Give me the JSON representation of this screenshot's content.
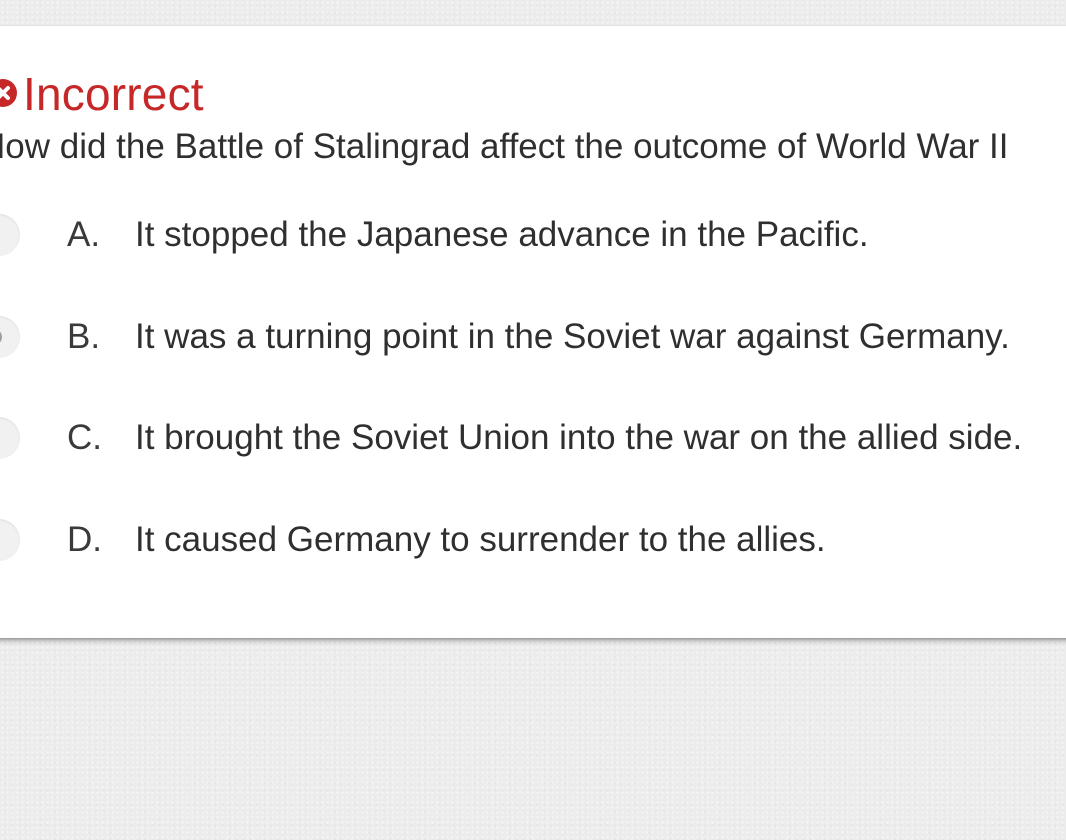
{
  "result": {
    "status_label": "Incorrect",
    "status_icon": "close-circle-icon",
    "status_color": "#c62828"
  },
  "question": {
    "text": "How did the Battle of Stalingrad affect the outcome of World War II"
  },
  "options": [
    {
      "letter": "A.",
      "text": "It stopped the Japanese advance in the Pacific.",
      "selected": false
    },
    {
      "letter": "B.",
      "text": "It was a turning point in the Soviet war against Germany.",
      "selected": true
    },
    {
      "letter": "C.",
      "text": "It brought the Soviet Union into the war on the allied side.",
      "selected": false
    },
    {
      "letter": "D.",
      "text": "It caused Germany to surrender to the allies.",
      "selected": false
    }
  ]
}
